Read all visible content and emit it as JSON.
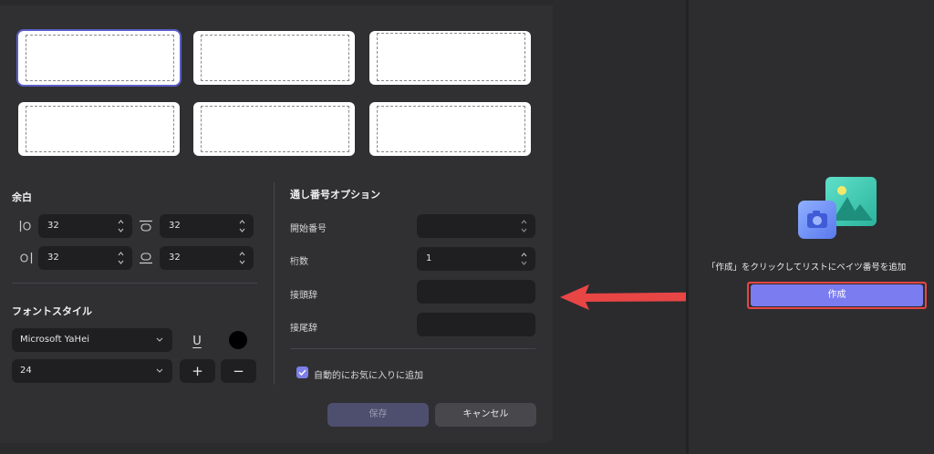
{
  "margins": {
    "title": "余白",
    "left": "32",
    "top": "32",
    "right": "32",
    "bottom": "32"
  },
  "font_style": {
    "title": "フォントスタイル",
    "font_name": "Microsoft YaHei",
    "font_size": "24",
    "underline_glyph": "U",
    "plus": "+",
    "minus": "−",
    "color": "#000000"
  },
  "numbering": {
    "title": "通し番号オプション",
    "start_label": "開始番号",
    "start_value": "",
    "digits_label": "桁数",
    "digits_value": "1",
    "prefix_label": "接頭辞",
    "prefix_value": "",
    "suffix_label": "接尾辞",
    "suffix_value": "",
    "auto_fav_label": "自動的にお気に入りに追加",
    "auto_fav_checked": true
  },
  "footer": {
    "save": "保存",
    "cancel": "キャンセル"
  },
  "right": {
    "hint": "「作成」をクリックしてリストにベイツ番号を追加",
    "create": "作成"
  },
  "colors": {
    "accent": "#7b7cf0",
    "highlight": "#e84545",
    "panel": "#303033"
  }
}
